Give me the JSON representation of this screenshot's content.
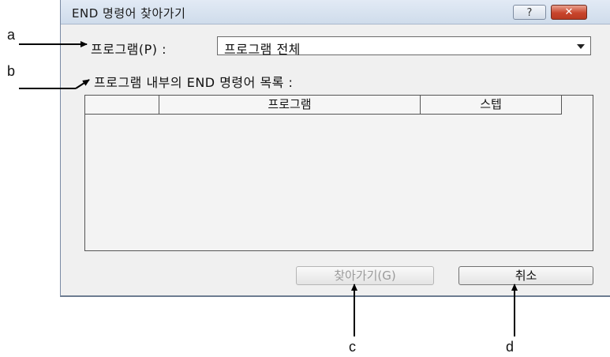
{
  "dialog": {
    "title": "END 명령어 찾아가기",
    "help_button": "?",
    "close_button": "✕",
    "program_label": "프로그램(P) :",
    "program_combo_value": "프로그램 전체",
    "list_label": "프로그램 내부의 END 명령어 목록 :",
    "columns": [
      "",
      "프로그램",
      "스텝"
    ],
    "goto_button": "찾아가기(G)",
    "cancel_button": "취소"
  },
  "callouts": [
    "a",
    "b",
    "c",
    "d"
  ]
}
